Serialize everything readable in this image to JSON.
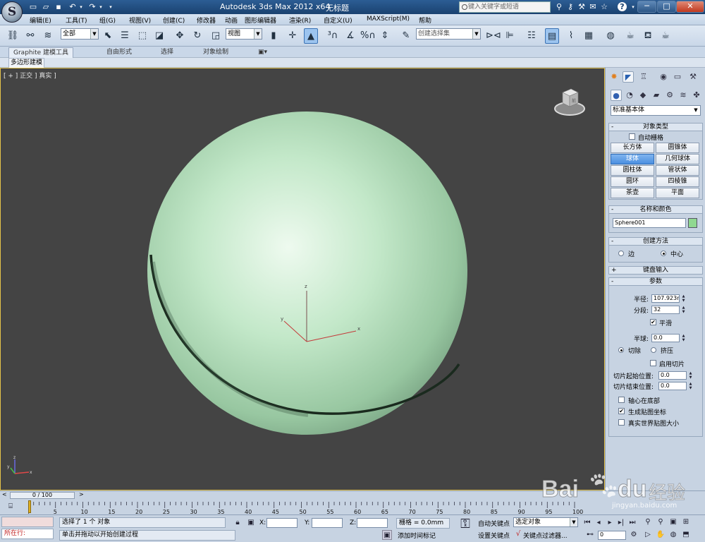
{
  "titlebar": {
    "app_logo_letter": "S",
    "title": "Autodesk 3ds Max  2012 x64",
    "file": "无标题",
    "search_placeholder": "键入关键字或短语",
    "window_controls": {
      "minimize": "─",
      "maximize": "□",
      "close": "✕"
    }
  },
  "menubar": [
    "编辑(E)",
    "工具(T)",
    "组(G)",
    "视图(V)",
    "创建(C)",
    "修改器",
    "动画",
    "图形编辑器",
    "渲染(R)",
    "自定义(U)",
    "MAXScript(M)",
    "帮助"
  ],
  "toolbar": {
    "selection_filter": "全部",
    "reference_coord": "视图",
    "named_selection": "创建选择集"
  },
  "ribbon": {
    "tabs": [
      "Graphite 建模工具",
      "自由形式",
      "选择",
      "对象绘制"
    ],
    "sub_tab": "多边形建模"
  },
  "viewport": {
    "label": "[ + ] 正交 ] 真实 ]",
    "gizmo_x": "x",
    "gizmo_y": "y",
    "gizmo_z": "z",
    "tripod_x": "x",
    "tripod_y": "y",
    "tripod_z": "z",
    "viewcube_label": "前"
  },
  "command_panel": {
    "category": "标准基本体",
    "object_type": {
      "title": "对象类型",
      "autogrid": "自动栅格",
      "buttons": [
        "长方体",
        "圆锥体",
        "球体",
        "几何球体",
        "圆柱体",
        "管状体",
        "圆环",
        "四棱锥",
        "茶壶",
        "平面"
      ],
      "selected": "球体"
    },
    "name_color": {
      "title": "名称和颜色",
      "name": "Sphere001",
      "color": "#90d890"
    },
    "creation_method": {
      "title": "创建方法",
      "edge": "边",
      "center": "中心",
      "selected": "中心"
    },
    "keyboard_entry": {
      "title": "键盘输入"
    },
    "parameters": {
      "title": "参数",
      "radius_label": "半径:",
      "radius": "107.923m",
      "segments_label": "分段:",
      "segments": "32",
      "smooth_label": "平滑",
      "smooth": true,
      "hemisphere_label": "半球:",
      "hemisphere": "0.0",
      "chop_label": "切除",
      "squash_label": "挤压",
      "slice_on_label": "启用切片",
      "slice_from_label": "切片起始位置:",
      "slice_from": "0.0",
      "slice_to_label": "切片结束位置:",
      "slice_to": "0.0",
      "base_to_pivot_label": "轴心在底部",
      "gen_mapping_label": "生成贴图坐标",
      "real_world_label": "真实世界贴图大小"
    }
  },
  "timeline": {
    "frame": "0 / 100",
    "ticks": [
      "0",
      "5",
      "10",
      "15",
      "20",
      "25",
      "30",
      "35",
      "40",
      "45",
      "50",
      "55",
      "60",
      "65",
      "70",
      "75",
      "80",
      "85",
      "90",
      "95",
      "100"
    ]
  },
  "status": {
    "script_listener": "所在行:",
    "selection": "选择了 1 个 对象",
    "prompt": "单击并拖动以开始创建过程",
    "x_label": "X:",
    "y_label": "Y:",
    "z_label": "Z:",
    "grid": "栅格 = 0.0mm",
    "add_time_tag": "添加时间标记",
    "auto_key": "自动关键点",
    "set_key": "设置关键点",
    "selected_set": "选定对象",
    "key_filters": "关键点过滤器...",
    "current_frame": "0"
  },
  "watermark": {
    "brand": "Bai",
    "brand2": "du",
    "text": "经验",
    "url": "jingyan.baidu.com"
  }
}
